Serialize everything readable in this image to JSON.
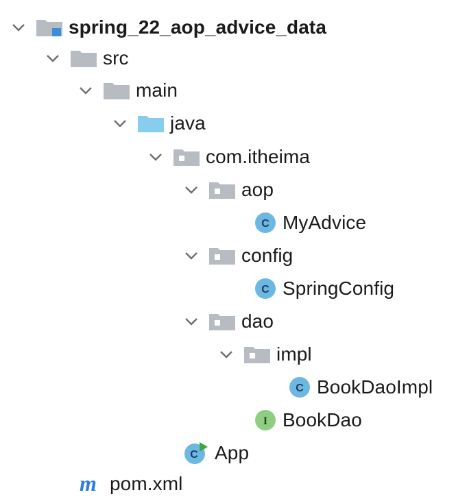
{
  "tree": {
    "root": {
      "label": "spring_22_aop_advice_data",
      "icon": "module-folder-icon"
    },
    "src": {
      "label": "src",
      "icon": "folder-icon"
    },
    "main": {
      "label": "main",
      "icon": "folder-icon"
    },
    "java": {
      "label": "java",
      "icon": "source-root-folder-icon"
    },
    "com_itheima": {
      "label": "com.itheima",
      "icon": "package-icon"
    },
    "aop": {
      "label": "aop",
      "icon": "package-icon"
    },
    "myadvice": {
      "label": "MyAdvice",
      "icon": "class-icon",
      "badge": "C"
    },
    "config": {
      "label": "config",
      "icon": "package-icon"
    },
    "springconfig": {
      "label": "SpringConfig",
      "icon": "class-icon",
      "badge": "C"
    },
    "dao": {
      "label": "dao",
      "icon": "package-icon"
    },
    "impl": {
      "label": "impl",
      "icon": "package-icon"
    },
    "bookdaoimpl": {
      "label": "BookDaoImpl",
      "icon": "class-icon",
      "badge": "C"
    },
    "bookdao": {
      "label": "BookDao",
      "icon": "interface-icon",
      "badge": "I"
    },
    "app": {
      "label": "App",
      "icon": "runnable-class-icon",
      "badge": "C"
    },
    "pom": {
      "label": "pom.xml",
      "icon": "maven-icon",
      "badge": "m"
    }
  },
  "colors": {
    "folder": "#b7bcc2",
    "source_root": "#86cdee",
    "class_badge": "#6cb8e3",
    "interface_badge": "#8fce82",
    "run_arrow": "#3ca83c",
    "maven": "#2a7fd8",
    "chevron": "#6e6e6e"
  }
}
